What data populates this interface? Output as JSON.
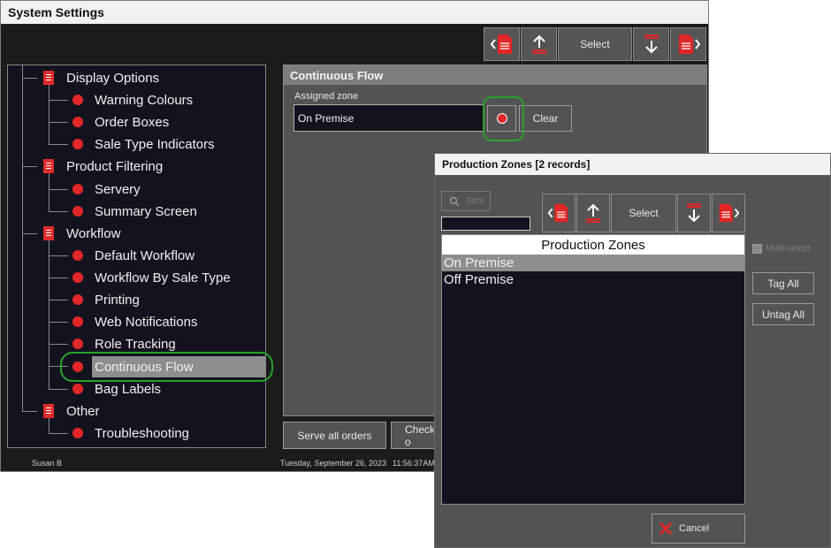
{
  "window": {
    "title": "System Settings"
  },
  "toolbar": {
    "select_label": "Select"
  },
  "tree": {
    "items": [
      {
        "label": "Display Options",
        "icon": "document-icon"
      },
      {
        "label": "Warning Colours",
        "icon": "dot-icon"
      },
      {
        "label": "Order Boxes",
        "icon": "dot-icon"
      },
      {
        "label": "Sale Type Indicators",
        "icon": "dot-icon"
      },
      {
        "label": "Product Filtering",
        "icon": "document-icon"
      },
      {
        "label": "Servery",
        "icon": "dot-icon"
      },
      {
        "label": "Summary Screen",
        "icon": "dot-icon"
      },
      {
        "label": "Workflow",
        "icon": "document-icon"
      },
      {
        "label": "Default Workflow",
        "icon": "dot-icon"
      },
      {
        "label": "Workflow By Sale Type",
        "icon": "dot-icon"
      },
      {
        "label": "Printing",
        "icon": "dot-icon"
      },
      {
        "label": "Web Notifications",
        "icon": "dot-icon"
      },
      {
        "label": "Role Tracking",
        "icon": "dot-icon"
      },
      {
        "label": "Continuous Flow",
        "icon": "dot-icon"
      },
      {
        "label": "Bag Labels",
        "icon": "dot-icon"
      },
      {
        "label": "Other",
        "icon": "document-icon"
      },
      {
        "label": "Troubleshooting",
        "icon": "dot-icon"
      }
    ],
    "selected": "Continuous Flow"
  },
  "panel": {
    "title": "Continuous Flow",
    "assigned_zone_label": "Assigned zone",
    "assigned_zone_value": "On Premise",
    "clear_label": "Clear",
    "serve_all_label": "Serve all orders",
    "check_label": "Check o"
  },
  "status": {
    "user": "Susan B",
    "date": "Tuesday, September 26, 2023",
    "time": "11:56:37AM"
  },
  "dialog": {
    "title": "Production Zones [2 records]",
    "search_placeholder": "Item",
    "select_label": "Select",
    "list_header": "Production Zones",
    "rows": [
      "On Premise",
      "Off Premise"
    ],
    "multiselect_label": "Multi-select",
    "tag_all_label": "Tag All",
    "untag_all_label": "Untag All",
    "cancel_label": "Cancel"
  },
  "colors": {
    "accent_red": "#e12727",
    "highlight_green": "#2aa12a",
    "selection_grey": "#8e8e8e"
  }
}
